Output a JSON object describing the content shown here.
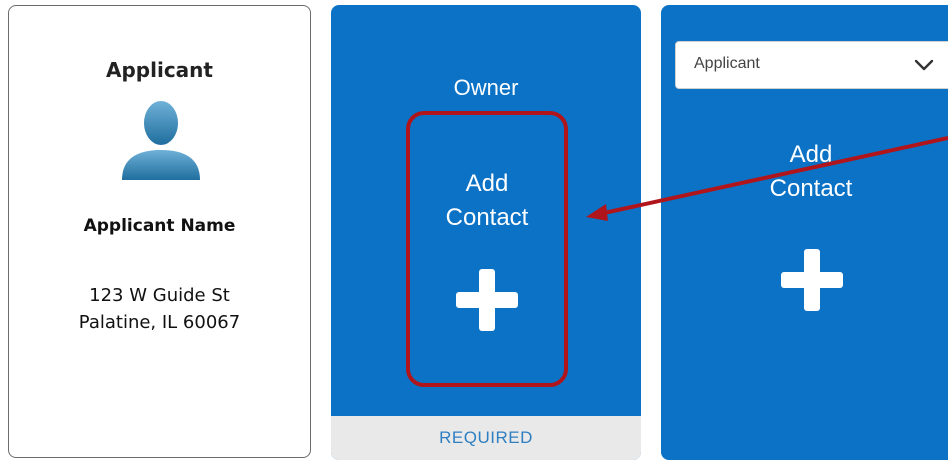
{
  "applicant_card": {
    "title": "Applicant",
    "name": "Applicant Name",
    "address_line1": "123 W Guide St",
    "address_line2": "Palatine, IL 60067",
    "avatar_icon": "person-silhouette-icon"
  },
  "owner_card": {
    "role": "Owner",
    "add_contact_line1": "Add",
    "add_contact_line2": "Contact",
    "add_icon": "plus-icon",
    "footer": "REQUIRED"
  },
  "select_card": {
    "selected_value": "Applicant",
    "chevron_icon": "chevron-down-icon",
    "add_contact_line1": "Add",
    "add_contact_line2": "Contact",
    "add_icon": "plus-icon"
  },
  "colors": {
    "card_blue": "#0b72c6",
    "highlight_red": "#b0151c",
    "required_text": "#2e7fc2",
    "required_bg": "#e9e9e9"
  }
}
